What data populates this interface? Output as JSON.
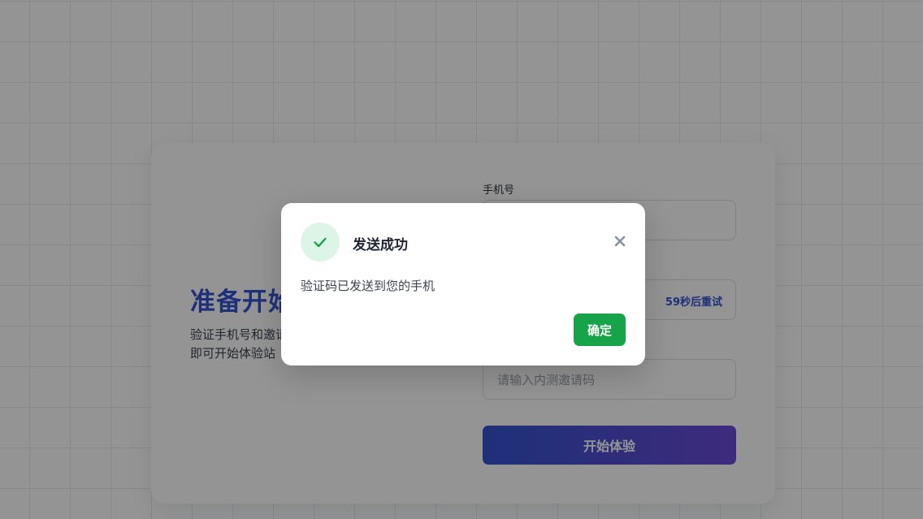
{
  "page": {
    "hero": {
      "title": "准备开始",
      "description_line1": "验证手机号和邀请",
      "description_line2": "即可开始体验站"
    },
    "form": {
      "phone_label": "手机号",
      "resend_countdown": "59秒后重试",
      "invite_placeholder": "请输入内测邀请码",
      "submit_label": "开始体验"
    }
  },
  "modal": {
    "title": "发送成功",
    "message": "验证码已发送到您的手机",
    "confirm_label": "确定",
    "icons": {
      "status": "checkmark-icon",
      "close": "close-icon"
    },
    "colors": {
      "success": "#16a34a",
      "success_bg": "#dcf5e6"
    }
  },
  "colors": {
    "brand": "#3454d1",
    "brand_gradient_end": "#6c4ad8"
  }
}
